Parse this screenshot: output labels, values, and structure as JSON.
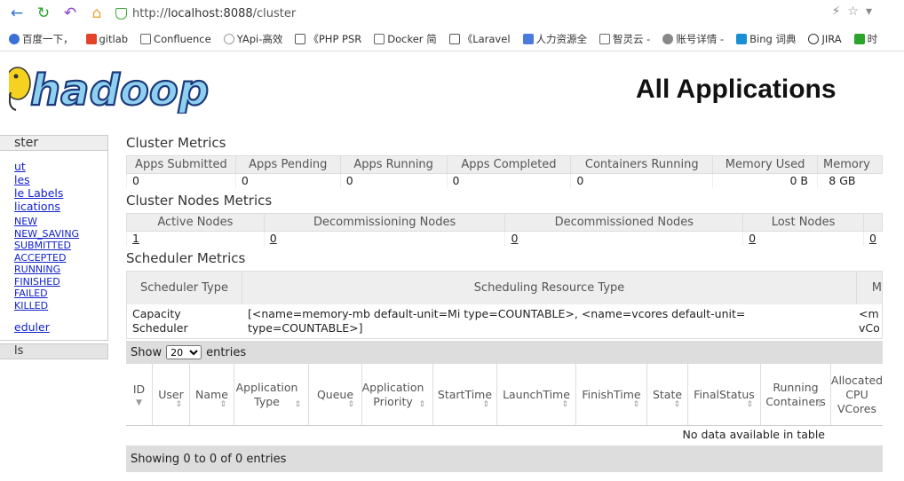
{
  "browser": {
    "url_prefix": "http://",
    "url_host": "localhost:8088",
    "url_path": "/cluster",
    "bookmarks": [
      "百度一下，",
      "gitlab",
      "Confluence",
      "YApi-高效",
      "《PHP PSR",
      "Docker 简",
      "《Laravel",
      "人力资源全",
      "智灵云 -",
      "账号详情 -",
      "Bing 词典",
      "JIRA",
      "时"
    ]
  },
  "header": {
    "logo_text": "hadoop",
    "title": "All Applications"
  },
  "leftnav": {
    "section": "ster",
    "links": [
      "ut",
      "les",
      "le Labels",
      "lications"
    ],
    "states": [
      "NEW",
      "NEW_SAVING",
      "SUBMITTED",
      "ACCEPTED",
      "RUNNING",
      "FINISHED",
      "FAILED",
      "KILLED"
    ],
    "scheduler": "eduler",
    "tools": "ls"
  },
  "cluster_metrics": {
    "title": "Cluster Metrics",
    "headers": [
      "Apps Submitted",
      "Apps Pending",
      "Apps Running",
      "Apps Completed",
      "Containers Running",
      "Memory Used",
      "Memory"
    ],
    "values": [
      "0",
      "0",
      "0",
      "0",
      "0",
      "0 B",
      "8 GB"
    ]
  },
  "nodes_metrics": {
    "title": "Cluster Nodes Metrics",
    "headers": [
      "Active Nodes",
      "Decommissioning Nodes",
      "Decommissioned Nodes",
      "Lost Nodes",
      ""
    ],
    "values": [
      "1",
      "0",
      "0",
      "0",
      "0"
    ]
  },
  "scheduler_metrics": {
    "title": "Scheduler Metrics",
    "headers": [
      "Scheduler Type",
      "Scheduling Resource Type",
      "M"
    ],
    "type": "Capacity Scheduler",
    "resource_type": "[<name=memory-mb default-unit=Mi type=COUNTABLE>, <name=vcores default-unit= type=COUNTABLE>]",
    "extra": "<m vCo"
  },
  "apps": {
    "show_label": "Show",
    "entries_label": "entries",
    "page_size": "20",
    "columns": [
      "ID",
      "User",
      "Name",
      "Application Type",
      "Queue",
      "Application Priority",
      "StartTime",
      "LaunchTime",
      "FinishTime",
      "State",
      "FinalStatus",
      "Running Containers",
      "Allocated CPU VCores"
    ],
    "no_data": "No data available in table",
    "footer": "Showing 0 to 0 of 0 entries"
  }
}
